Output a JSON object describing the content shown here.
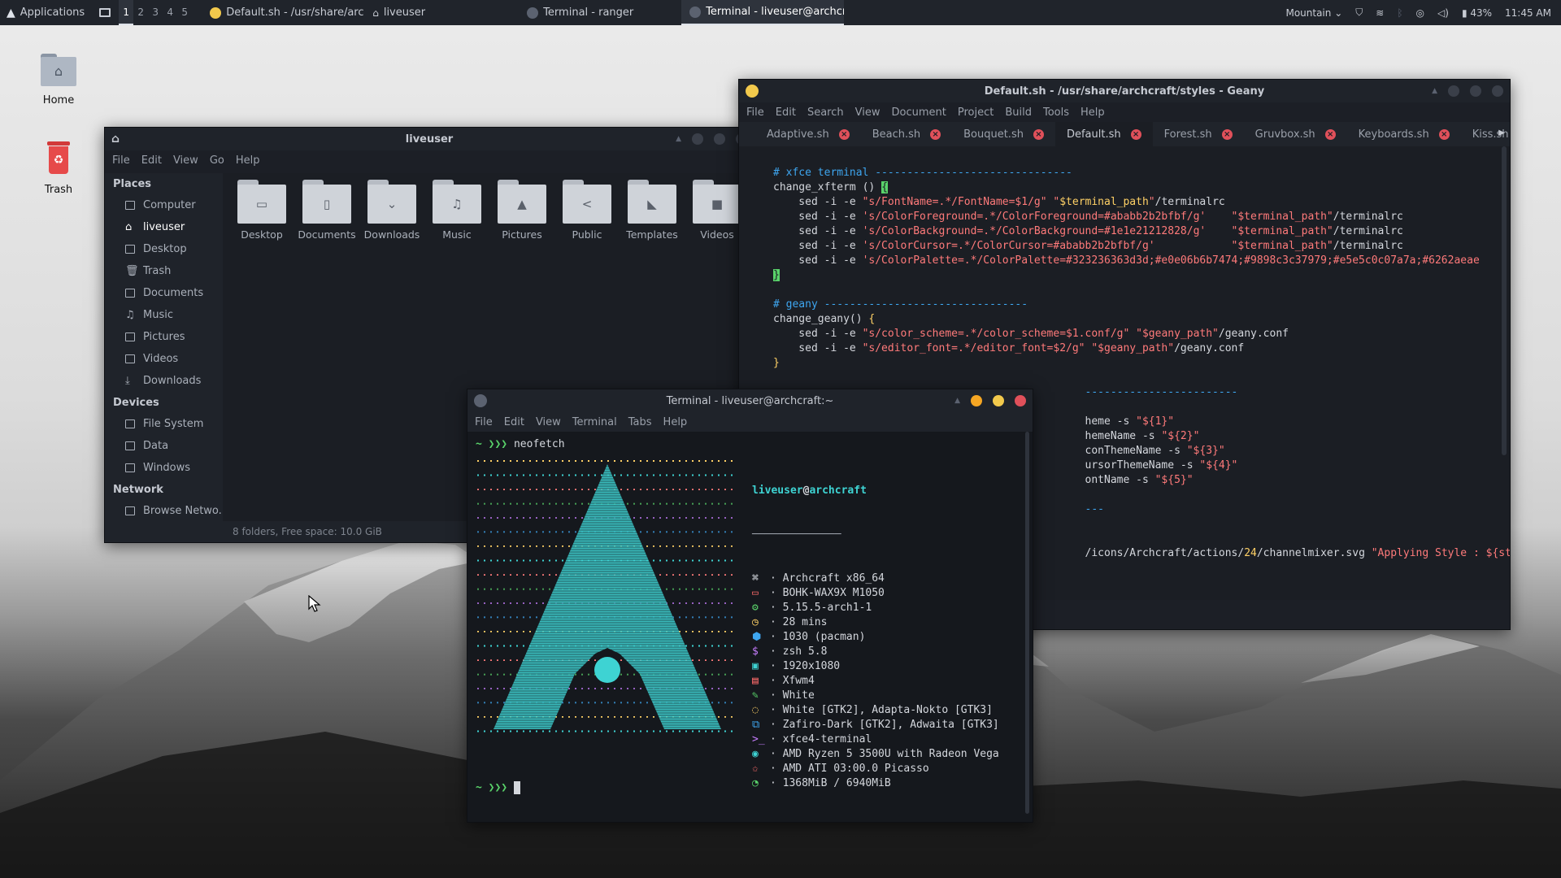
{
  "panel": {
    "applications": "Applications",
    "workspaces": [
      "1",
      "2",
      "3",
      "4",
      "5"
    ],
    "tasks": [
      {
        "label": "Default.sh - /usr/share/archc...",
        "color": "#f2c94c"
      },
      {
        "label": "liveuser",
        "color": "#c8ccd4"
      },
      {
        "label": "Terminal - ranger",
        "color": "#5b6270"
      },
      {
        "label": "Terminal - liveuser@archcraf...",
        "color": "#5b6270"
      }
    ],
    "weather": "Mountain",
    "battery": "43%",
    "clock": "11:45 AM"
  },
  "desktop": {
    "home_label": "Home",
    "trash_label": "Trash"
  },
  "filemanager": {
    "title": "liveuser",
    "menu": [
      "File",
      "Edit",
      "View",
      "Go",
      "Help"
    ],
    "places_header": "Places",
    "places": [
      "Computer",
      "liveuser",
      "Desktop",
      "Trash",
      "Documents",
      "Music",
      "Pictures",
      "Videos",
      "Downloads"
    ],
    "devices_header": "Devices",
    "devices": [
      "File System",
      "Data",
      "Windows"
    ],
    "network_header": "Network",
    "network": [
      "Browse Netwo..."
    ],
    "folders": [
      {
        "name": "Desktop",
        "glyph": "▭"
      },
      {
        "name": "Documents",
        "glyph": "▯"
      },
      {
        "name": "Downloads",
        "glyph": "⌄"
      },
      {
        "name": "Music",
        "glyph": "♫"
      },
      {
        "name": "Pictures",
        "glyph": "▲"
      },
      {
        "name": "Public",
        "glyph": "<"
      },
      {
        "name": "Templates",
        "glyph": "◣"
      },
      {
        "name": "Videos",
        "glyph": "■"
      }
    ],
    "status": "8 folders, Free space: 10.0 GiB"
  },
  "geany": {
    "title": "Default.sh - /usr/share/archcraft/styles - Geany",
    "menu": [
      "File",
      "Edit",
      "Search",
      "View",
      "Document",
      "Project",
      "Build",
      "Tools",
      "Help"
    ],
    "tabs": [
      "Adaptive.sh",
      "Beach.sh",
      "Bouquet.sh",
      "Default.sh",
      "Forest.sh",
      "Gruvbox.sh",
      "Keyboards.sh",
      "Kiss.sh"
    ],
    "active_tab": "Default.sh"
  },
  "terminal": {
    "title": "Terminal - liveuser@archcraft:~",
    "menu": [
      "File",
      "Edit",
      "View",
      "Terminal",
      "Tabs",
      "Help"
    ],
    "prompt": "~ ❯❯❯",
    "command": "neofetch",
    "user": "liveuser",
    "at": "@",
    "host": "archcraft",
    "underline": "──────────────",
    "info": [
      {
        "icon": "⌘",
        "color": "#e0e4ea",
        "text": "Archcraft x86_64"
      },
      {
        "icon": "▭",
        "color": "#ff6b6b",
        "text": "BOHK-WAX9X M1050"
      },
      {
        "icon": "⚙",
        "color": "#59d26a",
        "text": "5.15.5-arch1-1"
      },
      {
        "icon": "◷",
        "color": "#ffd166",
        "text": "28 mins"
      },
      {
        "icon": "⬢",
        "color": "#3ea6f0",
        "text": "1030 (pacman)"
      },
      {
        "icon": "$",
        "color": "#c77dff",
        "text": "zsh 5.8"
      },
      {
        "icon": "▣",
        "color": "#3ed3d3",
        "text": "1920x1080"
      },
      {
        "icon": "▤",
        "color": "#ff6b6b",
        "text": "Xfwm4"
      },
      {
        "icon": "✎",
        "color": "#59d26a",
        "text": "White"
      },
      {
        "icon": "◌",
        "color": "#ffd166",
        "text": "White [GTK2], Adapta-Nokto [GTK3]"
      },
      {
        "icon": "⧉",
        "color": "#3ea6f0",
        "text": "Zafiro-Dark [GTK2], Adwaita [GTK3]"
      },
      {
        "icon": ">_",
        "color": "#c77dff",
        "text": "xfce4-terminal"
      },
      {
        "icon": "◉",
        "color": "#3ed3d3",
        "text": "AMD Ryzen 5 3500U with Radeon Vega"
      },
      {
        "icon": "✩",
        "color": "#ff6b6b",
        "text": "AMD ATI 03:00.0 Picasso"
      },
      {
        "icon": "◔",
        "color": "#59d26a",
        "text": "1368MiB / 6940MiB"
      }
    ],
    "swatches": [
      "#2b2f36",
      "#ff7a7a",
      "#59d26a",
      "#ffd166",
      "#3ea6f0",
      "#c77dff",
      "#3ed3d3",
      "#f5f0dc"
    ]
  }
}
